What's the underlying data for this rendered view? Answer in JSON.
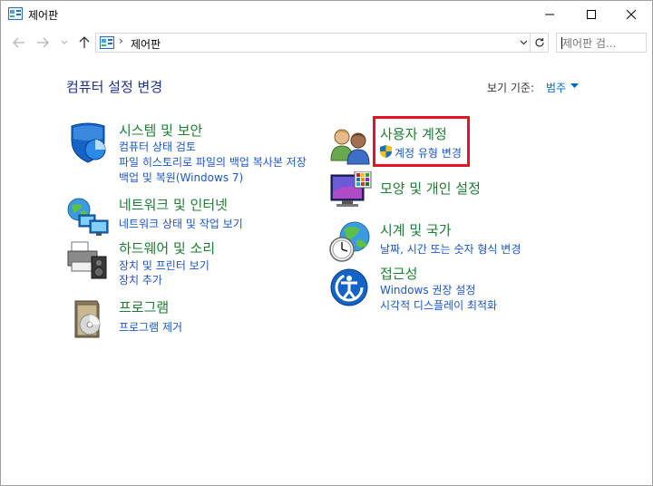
{
  "window": {
    "title": "제어판",
    "address_crumb": "제어판",
    "search_placeholder": "제어판 검...",
    "address_separator": "›"
  },
  "header": {
    "page_title": "컴퓨터 설정 변경",
    "view_by_label": "보기 기준:",
    "view_by_value": "범주"
  },
  "categories": {
    "system_security": {
      "title": "시스템 및 보안",
      "links": [
        "컴퓨터 상태 검토",
        "파일 히스토리로 파일의 백업 복사본 저장",
        "백업 및 복원(Windows 7)"
      ]
    },
    "network": {
      "title": "네트워크 및 인터넷",
      "links": [
        "네트워크 상태 및 작업 보기"
      ]
    },
    "hardware": {
      "title": "하드웨어 및 소리",
      "links": [
        "장치 및 프린터 보기",
        "장치 추가"
      ]
    },
    "programs": {
      "title": "프로그램",
      "links": [
        "프로그램 제거"
      ]
    },
    "user_accounts": {
      "title": "사용자 계정",
      "links": [
        "계정 유형 변경"
      ]
    },
    "appearance": {
      "title": "모양 및 개인 설정",
      "links": []
    },
    "clock_region": {
      "title": "시계 및 국가",
      "links": [
        "날짜, 시간 또는 숫자 형식 변경"
      ]
    },
    "ease_of_access": {
      "title": "접근성",
      "links": [
        "Windows 권장 설정",
        "시각적 디스플레이 최적화"
      ]
    }
  },
  "colors": {
    "heading_green": "#1e7d32",
    "link_blue": "#1a56c8",
    "title_navy": "#1e3287",
    "highlight_red": "#e81123"
  },
  "icons": {
    "app": "control-panel-icon",
    "system_security": "shield-icon",
    "network": "network-globe-icon",
    "hardware": "printer-speaker-icon",
    "programs": "programs-disc-icon",
    "user_accounts": "users-icon",
    "appearance": "monitor-palette-icon",
    "clock_region": "clock-globe-icon",
    "ease_of_access": "ease-of-access-icon"
  }
}
